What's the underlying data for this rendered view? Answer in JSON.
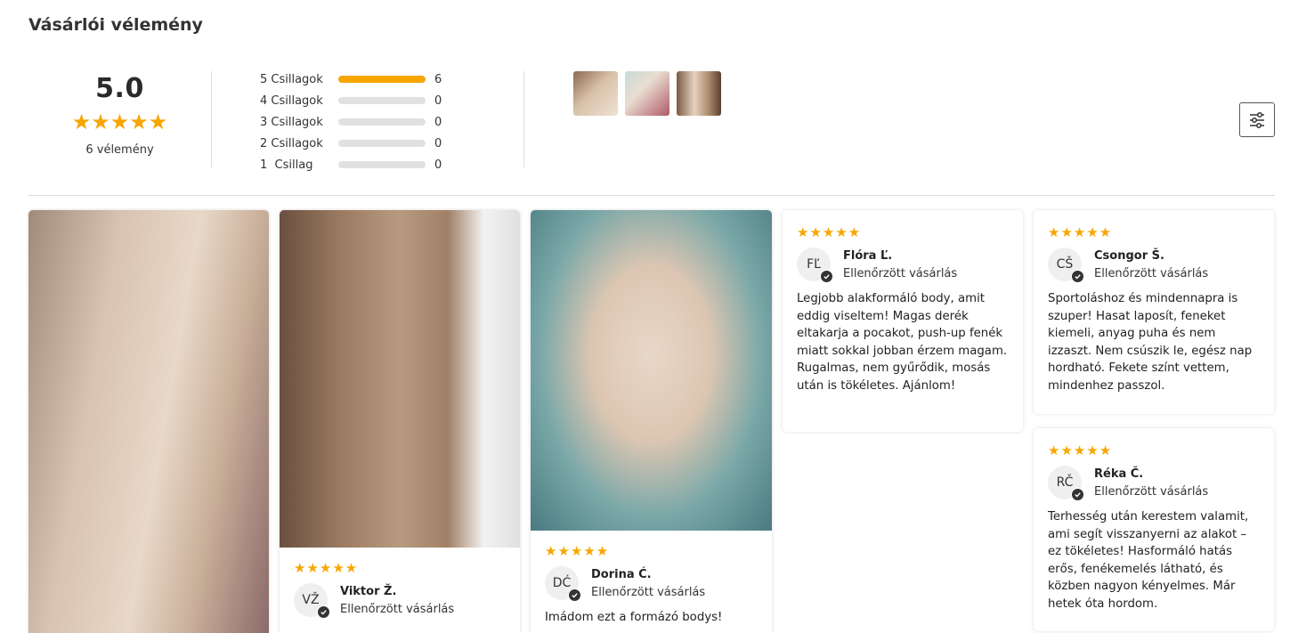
{
  "page": {
    "title": "Vásárlói vélemény"
  },
  "summary": {
    "average": "5.0",
    "rating_fraction": 1.0,
    "stars": "★★★★★",
    "count_label": "6 vélemény"
  },
  "breakdown": [
    {
      "label": "5 Csillagok",
      "count": "6",
      "fraction": 1.0
    },
    {
      "label": "4 Csillagok",
      "count": "0",
      "fraction": 0
    },
    {
      "label": "3 Csillagok",
      "count": "0",
      "fraction": 0
    },
    {
      "label": "2 Csillagok",
      "count": "0",
      "fraction": 0
    },
    {
      "label": "1  Csillag",
      "count": "0",
      "fraction": 0
    }
  ],
  "colors": {
    "star": "#f7a600",
    "bar_track": "#e1e1e1",
    "divider": "#dcdcdc"
  },
  "icons": {
    "filter": "sliders-icon",
    "verified": "check-badge-icon",
    "star": "star-icon"
  },
  "reviews": [
    {
      "stars": "★★★★★",
      "initials": "VŽ",
      "name": "Viktor Ž.",
      "verified": "Ellenőrzött vásárlás",
      "text": ""
    },
    {
      "stars": "★★★★★",
      "initials": "DĆ",
      "name": "Dorina Ć.",
      "verified": "Ellenőrzött vásárlás",
      "text": "Imádom ezt a formázó bodys!"
    },
    {
      "stars": "★★★★★",
      "initials": "FĽ",
      "name": "Flóra Ľ.",
      "verified": "Ellenőrzött vásárlás",
      "text": "Legjobb alakformáló body, amit eddig viseltem! Magas derék eltakarja a pocakot, push-up fenék miatt sokkal jobban érzem magam. Rugalmas, nem gyűrődik, mosás után is tökéletes. Ajánlom!"
    },
    {
      "stars": "★★★★★",
      "initials": "CŠ",
      "name": "Csongor Š.",
      "verified": "Ellenőrzött vásárlás",
      "text": "Sportoláshoz és mindennapra is szuper! Hasat laposít, feneket kiemeli, anyag puha és nem izzaszt. Nem csúszik le, egész nap hordható. Fekete színt vettem, mindenhez passzol."
    },
    {
      "stars": "★★★★★",
      "initials": "RČ",
      "name": "Réka Č.",
      "verified": "Ellenőrzött vásárlás",
      "text": "Terhesség után kerestem valamit, ami segít visszanyerni az alakot – ez tökéletes! Hasformáló hatás erős, fenékemelés látható, és közben nagyon kényelmes. Már hetek óta hordom."
    }
  ]
}
